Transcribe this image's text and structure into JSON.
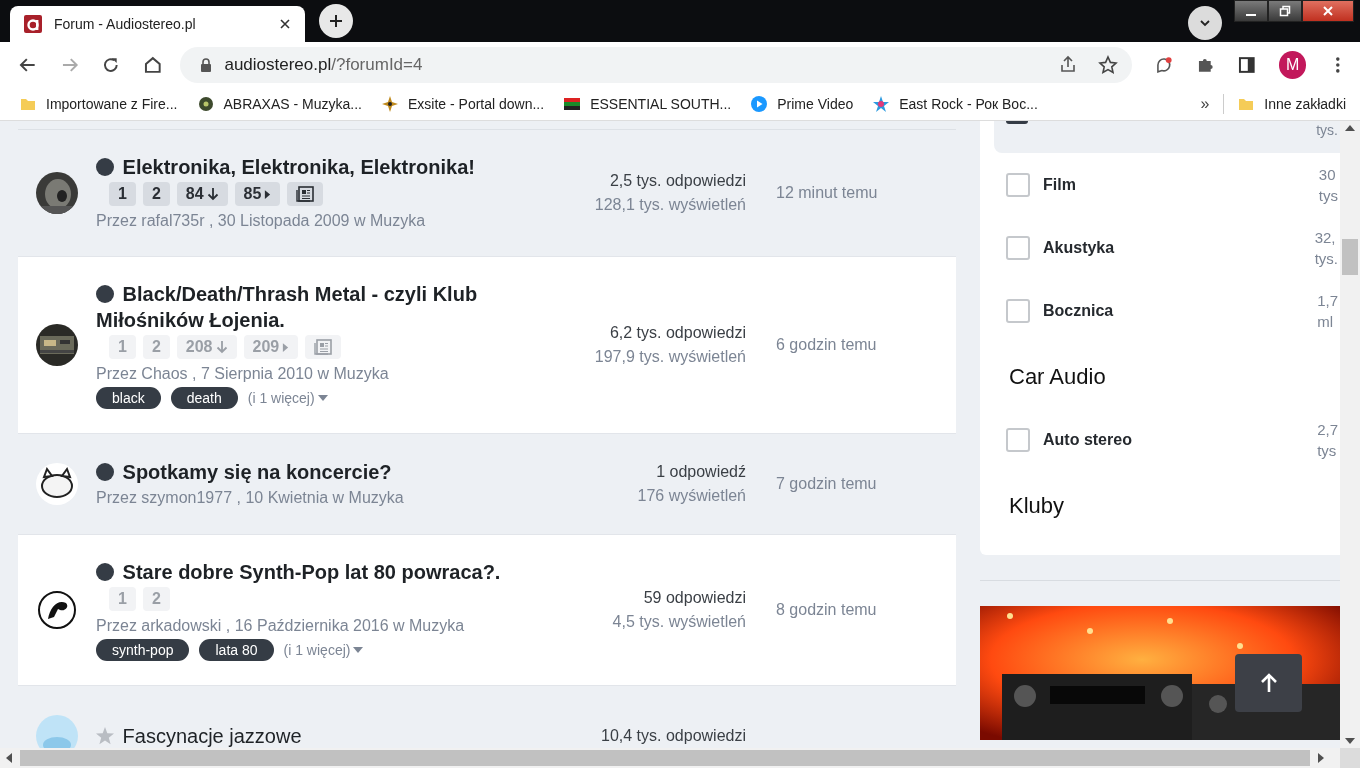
{
  "browser": {
    "tab": {
      "title": "Forum - Audiostereo.pl"
    },
    "address": {
      "domain": "audiostereo.pl",
      "path": "/?forumId=4"
    },
    "profile": "M",
    "bookmarks": [
      {
        "label": "Importowane z Fire..."
      },
      {
        "label": "ABRAXAS - Muzyka..."
      },
      {
        "label": "Exsite - Portal down..."
      },
      {
        "label": "ESSENTIAL SOUTH..."
      },
      {
        "label": "Prime Video"
      },
      {
        "label": "East Rock - Рок Вос..."
      }
    ],
    "overflow": "»",
    "other_bookmarks": "Inne zakładki"
  },
  "topics": [
    {
      "kind": "unread",
      "title": "Elektronika, Elektronika, Elektronika!",
      "pages_dimmed": false,
      "pages": [
        {
          "kind": "page",
          "label": "1"
        },
        {
          "kind": "page",
          "label": "2"
        },
        {
          "kind": "unread",
          "label": "84"
        },
        {
          "kind": "last",
          "label": "85"
        },
        {
          "kind": "preview"
        }
      ],
      "meta": "Przez rafal735r , 30 Listopada 2009 w Muzyka",
      "replies": "2,5 tys. odpowiedzi",
      "views": "128,1 tys. wyświetleń",
      "last": "12 minut temu"
    },
    {
      "kind": "unread",
      "title": "Black/Death/Thrash Metal - czyli Klub Miłośników Łojenia.",
      "pages_dimmed": true,
      "pages": [
        {
          "kind": "page",
          "label": "1"
        },
        {
          "kind": "page",
          "label": "2"
        },
        {
          "kind": "unread",
          "label": "208"
        },
        {
          "kind": "last",
          "label": "209"
        },
        {
          "kind": "preview"
        }
      ],
      "meta": "Przez Chaos , 7 Sierpnia 2010 w Muzyka",
      "tags": [
        "black",
        "death"
      ],
      "more": "(i 1 więcej)",
      "replies": "6,2 tys. odpowiedzi",
      "views": "197,9 tys. wyświetleń",
      "last": "6 godzin temu"
    },
    {
      "kind": "unread",
      "title": "Spotkamy się na koncercie?",
      "meta": "Przez szymon1977 , 10 Kwietnia w Muzyka",
      "replies": "1 odpowiedź",
      "views": "176 wyświetleń",
      "last": "7 godzin temu"
    },
    {
      "kind": "unread",
      "title": "Stare dobre Synth-Pop lat 80 powraca?.",
      "pages_dimmed": true,
      "pages": [
        {
          "kind": "page",
          "label": "1"
        },
        {
          "kind": "page",
          "label": "2"
        }
      ],
      "meta": "Przez arkadowski , 16 Października 2016 w Muzyka",
      "tags": [
        "synth-pop",
        "lata 80"
      ],
      "more": "(i 1 więcej)",
      "replies": "59 odpowiedzi",
      "views": "4,5 tys. wyświetleń",
      "last": "8 godzin temu"
    },
    {
      "kind": "starred",
      "title": "Fascynacje jazzowe",
      "replies": "10,4 tys. odpowiedzi"
    }
  ],
  "sidebar": {
    "partial_stat": "tys.",
    "sections": [
      {
        "items": [
          {
            "label": "Film",
            "checked": false,
            "stats": [
              "30",
              "tys"
            ]
          },
          {
            "label": "Akustyka",
            "checked": false,
            "stats": [
              "32,",
              "tys."
            ]
          },
          {
            "label": "Bocznica",
            "checked": false,
            "stats": [
              "1,7",
              "ml"
            ]
          }
        ]
      },
      {
        "heading": "Car Audio",
        "items": [
          {
            "label": "Auto stereo",
            "checked": false,
            "stats": [
              "2,7",
              "tys"
            ]
          }
        ]
      },
      {
        "heading": "Kluby"
      }
    ]
  }
}
